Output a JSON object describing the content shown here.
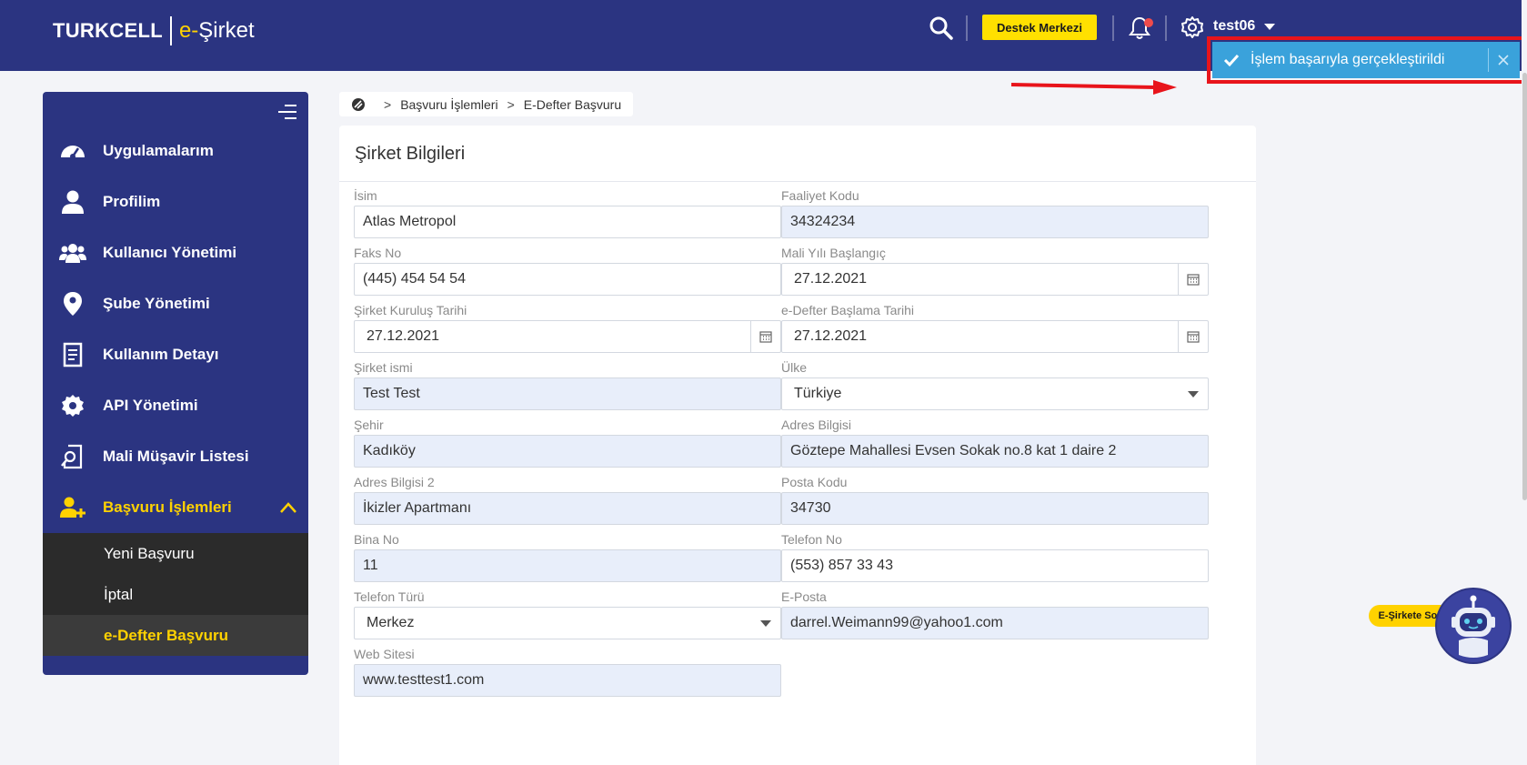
{
  "header": {
    "brand_primary": "TURKCELL",
    "brand_e": "e-",
    "brand_secondary": "Şirket",
    "support_label": "Destek Merkezi",
    "username": "test06"
  },
  "toast": {
    "message": "İşlem başarıyla gerçekleştirildi"
  },
  "breadcrumb": {
    "items": [
      "Başvuru İşlemleri",
      "E-Defter Başvuru"
    ]
  },
  "sidebar": {
    "items": [
      {
        "label": "Uygulamalarım",
        "icon": "dashboard-icon"
      },
      {
        "label": "Profilim",
        "icon": "user-icon"
      },
      {
        "label": "Kullanıcı Yönetimi",
        "icon": "users-icon"
      },
      {
        "label": "Şube Yönetimi",
        "icon": "location-pin-icon"
      },
      {
        "label": "Kullanım Detayı",
        "icon": "document-icon"
      },
      {
        "label": "API Yönetimi",
        "icon": "gear-icon"
      },
      {
        "label": "Mali Müşavir Listesi",
        "icon": "search-document-icon"
      },
      {
        "label": "Başvuru İşlemleri",
        "icon": "user-add-icon"
      }
    ],
    "sub_items": [
      "Yeni Başvuru",
      "İptal",
      "e-Defter Başvuru"
    ]
  },
  "form": {
    "title": "Şirket Bilgileri",
    "isim": {
      "label": "İsim",
      "value": "Atlas Metropol"
    },
    "faaliyet_kodu": {
      "label": "Faaliyet Kodu",
      "value": "34324234"
    },
    "faks_no": {
      "label": "Faks No",
      "value": "(445) 454 54 54"
    },
    "mali_yil": {
      "label": "Mali Yılı Başlangıç",
      "value": "27.12.2021"
    },
    "kurulus_tarihi": {
      "label": "Şirket Kuruluş Tarihi",
      "value": "27.12.2021"
    },
    "edefter_tarihi": {
      "label": "e-Defter Başlama Tarihi",
      "value": "27.12.2021"
    },
    "sirket_ismi": {
      "label": "Şirket ismi",
      "value": "Test Test"
    },
    "ulke": {
      "label": "Ülke",
      "value": "Türkiye"
    },
    "sehir": {
      "label": "Şehir",
      "value": "Kadıköy"
    },
    "adres": {
      "label": "Adres Bilgisi",
      "value": "Göztepe Mahallesi Evsen Sokak no.8 kat 1 daire 2"
    },
    "adres2": {
      "label": "Adres Bilgisi 2",
      "value": "İkizler Apartmanı"
    },
    "posta_kodu": {
      "label": "Posta Kodu",
      "value": "34730"
    },
    "bina_no": {
      "label": "Bina No",
      "value": "11"
    },
    "telefon_no": {
      "label": "Telefon No",
      "value": "(553) 857 33 43"
    },
    "telefon_turu": {
      "label": "Telefon Türü",
      "value": "Merkez"
    },
    "eposta": {
      "label": "E-Posta",
      "value": "darrel.Weimann99@yahoo1.com"
    },
    "web_sitesi": {
      "label": "Web Sitesi",
      "value": "www.testtest1.com"
    }
  },
  "chatbot": {
    "label": "E-Şirkete Sor"
  },
  "colors": {
    "header_bg": "#2b3481",
    "accent_yellow": "#ffd200",
    "toast_bg": "#3aa2db",
    "highlight_red": "#e8141b",
    "field_fill": "#e8eefa"
  }
}
